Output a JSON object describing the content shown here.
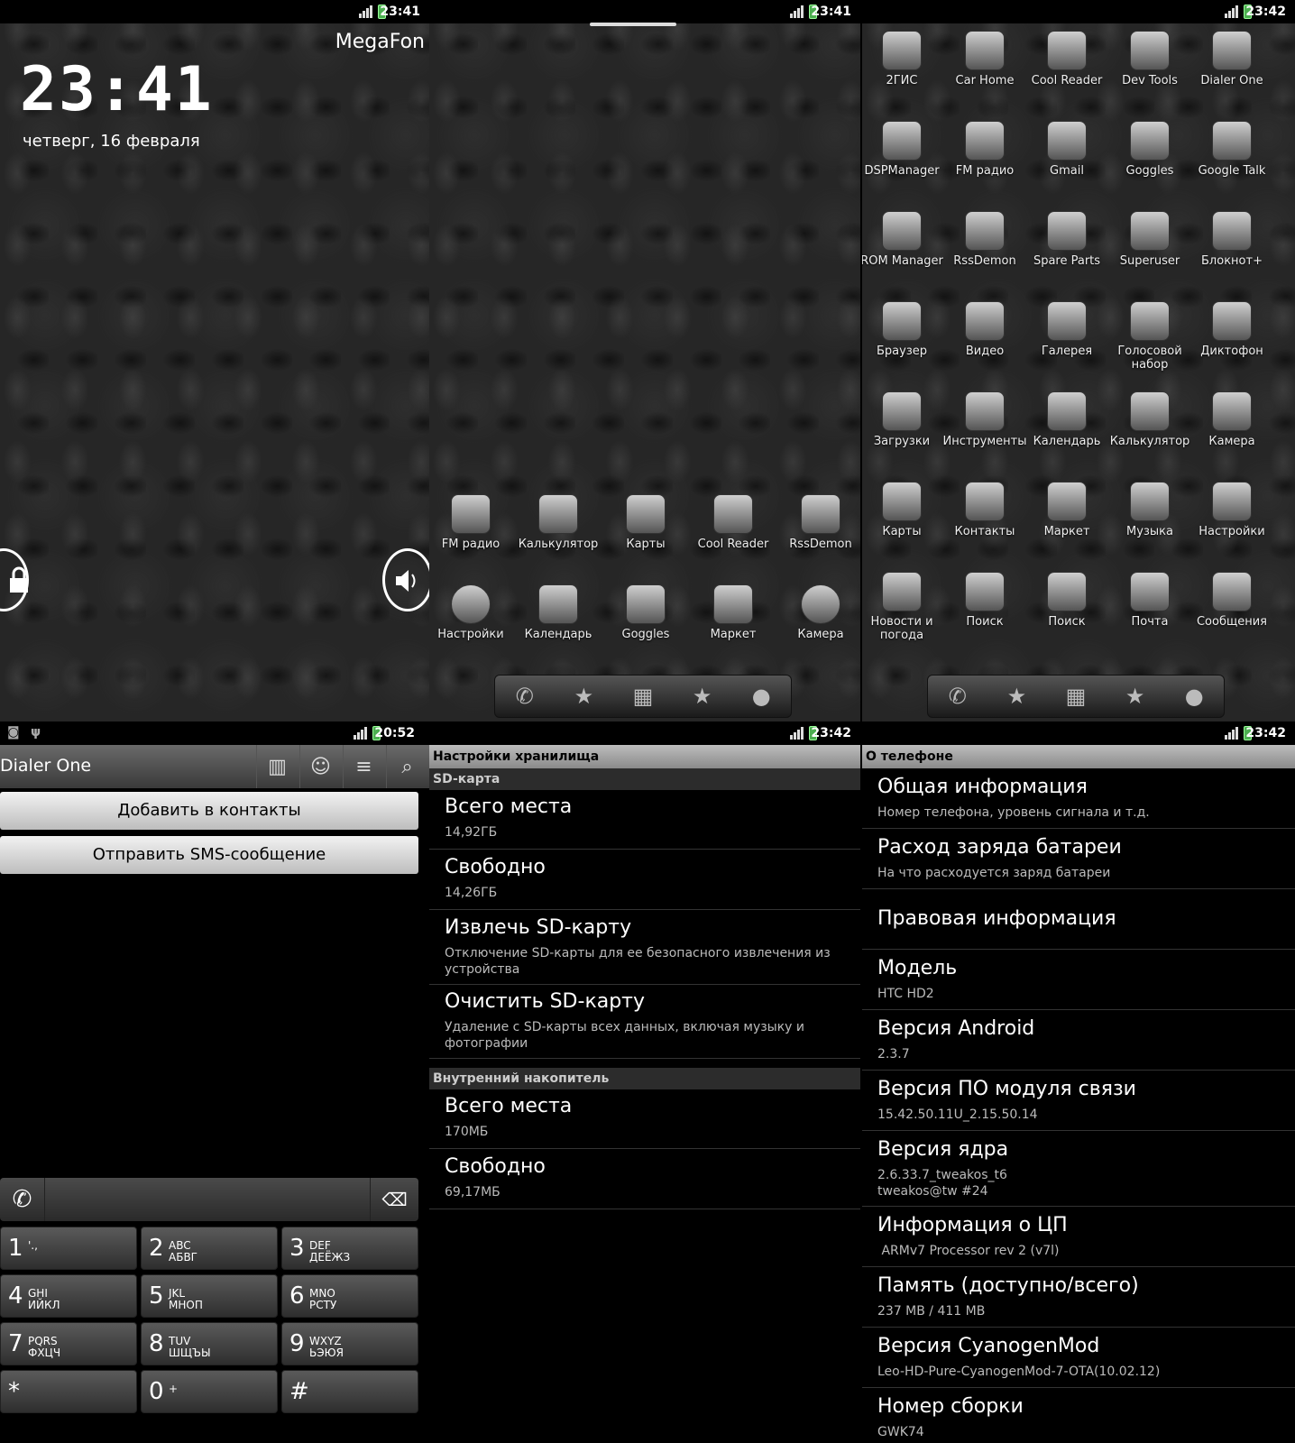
{
  "lockscreen": {
    "time": "23:41",
    "carrier": "MegaFon",
    "clock": "23:41",
    "date": "четверг, 16 февраля"
  },
  "home": {
    "time": "23:41",
    "apps": [
      {
        "label": "FM радио",
        "icon": "radio-icon"
      },
      {
        "label": "Калькулятор",
        "icon": "calculator-icon"
      },
      {
        "label": "Карты",
        "icon": "maps-icon"
      },
      {
        "label": "Cool Reader",
        "icon": "book-icon"
      },
      {
        "label": "RssDemon",
        "icon": "rss-icon"
      },
      {
        "label": "Настройки",
        "icon": "settings-icon"
      },
      {
        "label": "Календарь",
        "icon": "calendar-icon"
      },
      {
        "label": "Goggles",
        "icon": "goggles-icon"
      },
      {
        "label": "Маркет",
        "icon": "market-icon"
      },
      {
        "label": "Камера",
        "icon": "camera-icon"
      }
    ]
  },
  "drawer": {
    "time": "23:42",
    "apps": [
      "2ГИС",
      "Car Home",
      "Cool Reader",
      "Dev Tools",
      "Dialer One",
      "DSPManager",
      "FM радио",
      "Gmail",
      "Goggles",
      "Google Talk",
      "ROM Manager",
      "RssDemon",
      "Spare Parts",
      "Superuser",
      "Блокнот+",
      "Браузер",
      "Видео",
      "Галерея",
      "Голосовой набор",
      "Диктофон",
      "Загрузки",
      "Инструменты",
      "Календарь",
      "Калькулятор",
      "Камера",
      "Карты",
      "Контакты",
      "Маркет",
      "Музыка",
      "Настройки",
      "Новости и погода",
      "Поиск",
      "Поиск",
      "Почта",
      "Сообщения"
    ]
  },
  "dialer": {
    "time": "20:52",
    "title": "Dialer One",
    "add_contact": "Добавить в контакты",
    "send_sms": "Отправить SMS-сообщение",
    "keys": [
      {
        "n": "1",
        "l": "'.,"
      },
      {
        "n": "2",
        "l": "ABC\nАБВГ"
      },
      {
        "n": "3",
        "l": "DEF\nДЕЁЖЗ"
      },
      {
        "n": "4",
        "l": "GHI\nИЙКЛ"
      },
      {
        "n": "5",
        "l": "JKL\nМНОП"
      },
      {
        "n": "6",
        "l": "MNO\nРСТУ"
      },
      {
        "n": "7",
        "l": "PQRS\nФХЦЧ"
      },
      {
        "n": "8",
        "l": "TUV\nШЩЪЫ"
      },
      {
        "n": "9",
        "l": "WXYZ\nЬЭЮЯ"
      },
      {
        "n": "*",
        "l": ""
      },
      {
        "n": "0",
        "l": "+"
      },
      {
        "n": "#",
        "l": ""
      }
    ]
  },
  "storage": {
    "time": "23:42",
    "header": "Настройки хранилища",
    "sd_section": "SD-карта",
    "internal_section": "Внутренний накопитель",
    "items": [
      {
        "t": "Всего места",
        "s": "14,92ГБ"
      },
      {
        "t": "Свободно",
        "s": "14,26ГБ"
      },
      {
        "t": "Извлечь SD-карту",
        "s": "Отключение SD-карты для ее безопасного извлечения из устройства"
      },
      {
        "t": "Очистить SD-карту",
        "s": "Удаление с SD-карты всех данных, включая музыку и фотографии"
      },
      {
        "t": "Всего места",
        "s": "170МБ"
      },
      {
        "t": "Свободно",
        "s": "69,17МБ"
      }
    ]
  },
  "about": {
    "time": "23:42",
    "header": "О телефоне",
    "items": [
      {
        "t": "Общая информация",
        "s": "Номер телефона, уровень сигнала и т.д."
      },
      {
        "t": "Расход заряда батареи",
        "s": "На что расходуется заряд батареи"
      },
      {
        "t": "Правовая информация",
        "s": ""
      },
      {
        "t": "Модель",
        "s": "HTC HD2"
      },
      {
        "t": "Версия Android",
        "s": "2.3.7"
      },
      {
        "t": "Версия ПО модуля связи",
        "s": "15.42.50.11U_2.15.50.14"
      },
      {
        "t": "Версия ядра",
        "s": "2.6.33.7_tweakos_t6\ntweakos@tw #24"
      },
      {
        "t": "Информация о ЦП",
        "s": " ARMv7 Processor rev 2 (v7l)"
      },
      {
        "t": "Память (доступно/всего)",
        "s": "237 MB / 411 MB"
      },
      {
        "t": "Версия CyanogenMod",
        "s": "Leo-HD-Pure-CyanogenMod-7-OTA(10.02.12)"
      },
      {
        "t": "Номер сборки",
        "s": "GWK74"
      }
    ]
  }
}
